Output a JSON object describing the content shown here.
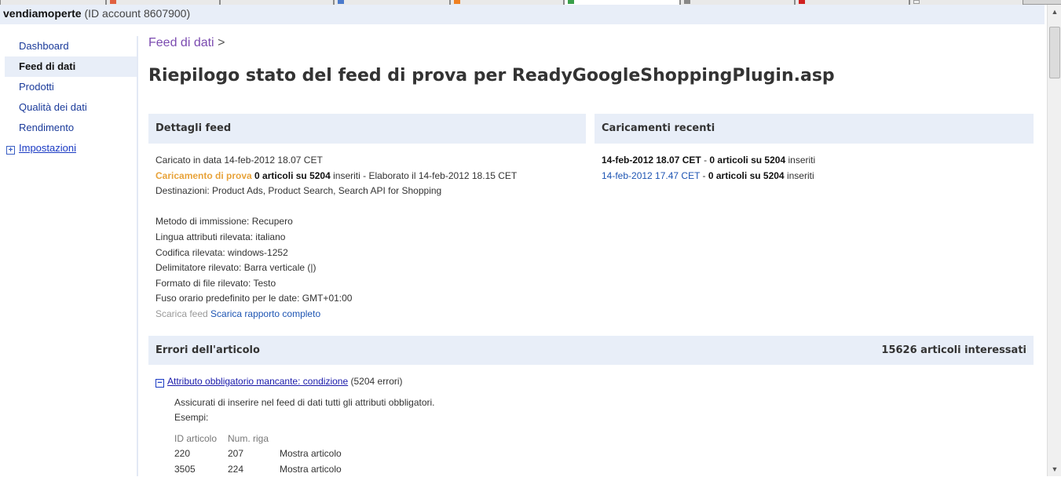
{
  "account": {
    "name": "vendiamoperte",
    "id_text": "(ID account 8607900)"
  },
  "sidebar": {
    "items": [
      {
        "label": "Dashboard"
      },
      {
        "label": "Feed di dati"
      },
      {
        "label": "Prodotti"
      },
      {
        "label": "Qualità dei dati"
      },
      {
        "label": "Rendimento"
      },
      {
        "label": "Impostazioni"
      }
    ],
    "active": "Feed di dati"
  },
  "breadcrumb": {
    "link": "Feed di dati",
    "separator": ">"
  },
  "page_title": "Riepilogo stato del feed di prova per ReadyGoogleShoppingPlugin.asp",
  "feed_details": {
    "heading": "Dettagli feed",
    "uploaded_on": "Caricato in data 14-feb-2012 18.07 CET",
    "test_upload_label": "Caricamento di prova",
    "test_upload_count": "0 articoli su 5204",
    "test_upload_rest": "inseriti - Elaborato il 14-feb-2012 18.15 CET",
    "destinations": "Destinazioni: Product Ads, Product Search, Search API for Shopping",
    "method": "Metodo di immissione: Recupero",
    "language": "Lingua attributi rilevata: italiano",
    "encoding": "Codifica rilevata: windows-1252",
    "delimiter": "Delimitatore rilevato: Barra verticale (|)",
    "file_format": "Formato di file rilevato: Testo",
    "timezone": "Fuso orario predefinito per le date: GMT+01:00",
    "download_feed": "Scarica feed",
    "download_report": "Scarica rapporto completo"
  },
  "recent_uploads": {
    "heading": "Caricamenti recenti",
    "rows": [
      {
        "date": "14-feb-2012 18.07 CET",
        "sep": " - ",
        "count": "0 articoli su 5204",
        "suffix": " inseriti",
        "is_link": false
      },
      {
        "date": "14-feb-2012 17.47 CET",
        "sep": " - ",
        "count": "0 articoli su 5204",
        "suffix": " inseriti",
        "is_link": true
      }
    ]
  },
  "item_errors": {
    "heading": "Errori dell'articolo",
    "affected": "15626 articoli interessati",
    "error": {
      "title": "Attributo obbligatorio mancante: condizione",
      "count": "(5204 errori)",
      "description": "Assicurati di inserire nel feed di dati tutti gli attributi obbligatori.",
      "examples_label": "Esempi:",
      "columns": [
        "ID articolo",
        "Num. riga"
      ],
      "rows": [
        {
          "id": "220",
          "line": "207",
          "action": "Mostra articolo"
        },
        {
          "id": "3505",
          "line": "224",
          "action": "Mostra articolo"
        }
      ]
    }
  },
  "colors": {
    "accent_orange": "#e8a33a",
    "link_blue": "#1e55b3",
    "panel_bg": "#e8eef8",
    "breadcrumb_purple": "#7b4bb0"
  }
}
